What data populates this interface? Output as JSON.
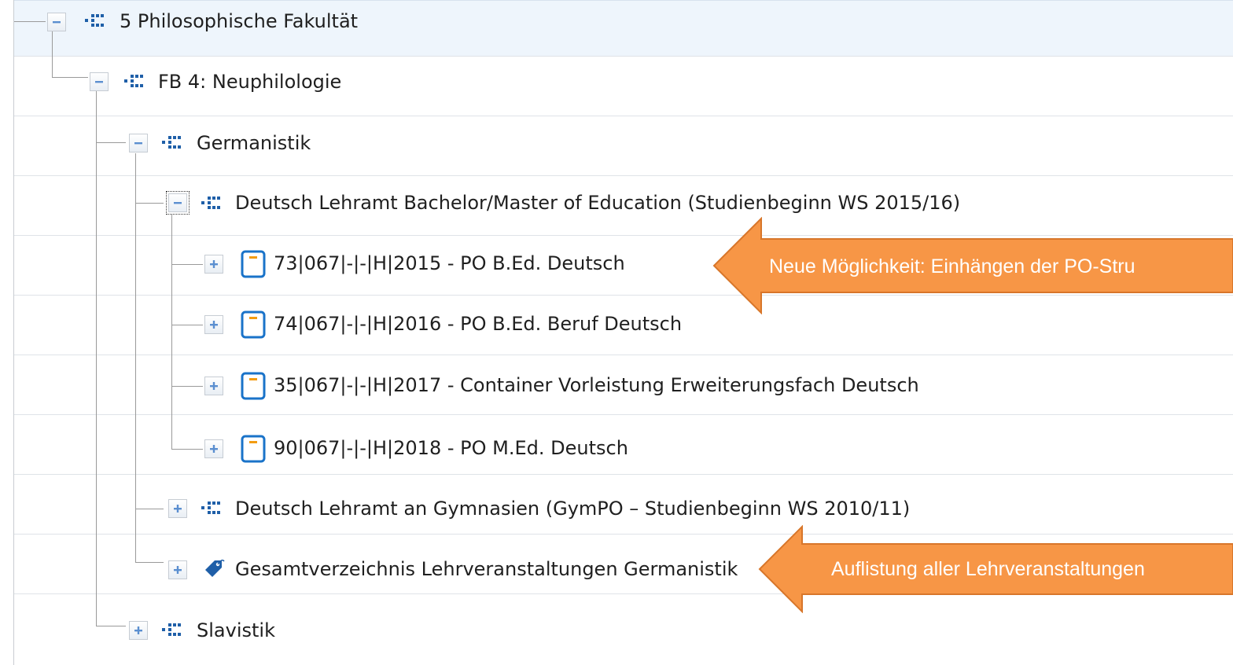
{
  "tree": {
    "nodes": [
      {
        "label": "5 Philosophische Fakultät",
        "icon": "org-unit-icon",
        "expanded": true
      },
      {
        "label": "FB 4: Neuphilologie",
        "icon": "org-unit-icon",
        "expanded": true
      },
      {
        "label": "Germanistik",
        "icon": "org-unit-icon",
        "expanded": true
      },
      {
        "label": "Deutsch Lehramt Bachelor/Master of Education (Studienbeginn WS 2015/16)",
        "icon": "org-unit-icon",
        "expanded": true
      },
      {
        "label": "73|067|-|-|H|2015 - PO B.Ed. Deutsch",
        "icon": "exam-regulation-icon",
        "expanded": false
      },
      {
        "label": "74|067|-|-|H|2016 - PO B.Ed. Beruf Deutsch",
        "icon": "exam-regulation-icon",
        "expanded": false
      },
      {
        "label": "35|067|-|-|H|2017 - Container Vorleistung Erweiterungsfach Deutsch",
        "icon": "exam-regulation-icon",
        "expanded": false
      },
      {
        "label": "90|067|-|-|H|2018 - PO M.Ed. Deutsch",
        "icon": "exam-regulation-icon",
        "expanded": false
      },
      {
        "label": "Deutsch Lehramt an Gymnasien (GymPO – Studienbeginn WS 2010/11)",
        "icon": "org-unit-icon",
        "expanded": false
      },
      {
        "label": "Gesamtverzeichnis Lehrveranstaltungen Germanistik",
        "icon": "tag-icon",
        "expanded": false
      },
      {
        "label": "Slavistik",
        "icon": "org-unit-icon",
        "expanded": false
      }
    ]
  },
  "callouts": [
    {
      "text": "Neue Möglichkeit: Einhängen der PO-Stru",
      "color": "#f79646"
    },
    {
      "text": "Auflistung aller Lehrveranstaltungen",
      "color": "#f79646"
    }
  ],
  "colors": {
    "row_highlight": "#eef5fc",
    "toggle_symbol": "#5b8fd0",
    "org_icon": "#1f5fa8",
    "doc_icon_border": "#1a73c9",
    "doc_icon_accent": "#f39c12"
  }
}
